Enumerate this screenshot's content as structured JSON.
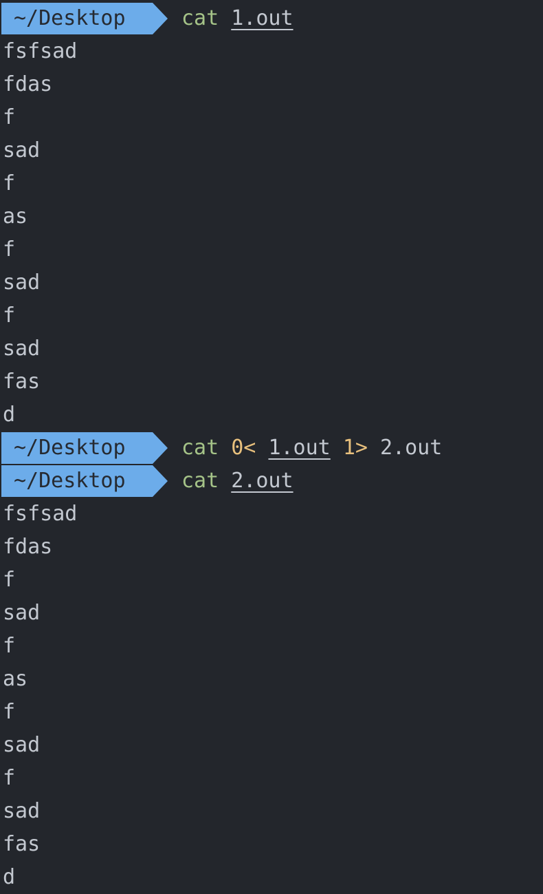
{
  "terminal": {
    "block1": {
      "prompt": "~/Desktop",
      "cmd": "cat",
      "file": "1.out",
      "output": [
        "fsfsad",
        "fdas",
        "f",
        "sad",
        "f",
        "as",
        "f",
        "sad",
        "f",
        "sad",
        "fas",
        "d"
      ]
    },
    "block2": {
      "prompt": "~/Desktop",
      "cmd": "cat",
      "redir_in": "0<",
      "file_in": "1.out",
      "redir_out": "1>",
      "file_out": "2.out"
    },
    "block3": {
      "prompt": "~/Desktop",
      "cmd": "cat",
      "file": "2.out",
      "output": [
        "fsfsad",
        "fdas",
        "f",
        "sad",
        "f",
        "as",
        "f",
        "sad",
        "f",
        "sad",
        "fas",
        "d"
      ]
    }
  },
  "colors": {
    "background": "#23262c",
    "prompt_bg": "#6cacea",
    "command": "#a5c388",
    "redirect": "#e8c07d",
    "text": "#c3c8d0"
  }
}
